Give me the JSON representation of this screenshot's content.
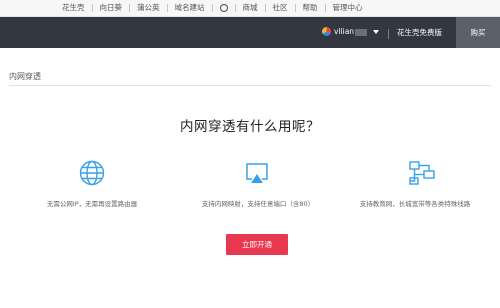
{
  "topnav": {
    "items": [
      "花生壳",
      "向日葵",
      "蒲公英",
      "域名建站",
      "商城",
      "社区",
      "帮助",
      "管理中心"
    ]
  },
  "header": {
    "user_name": "vllian",
    "product_name": "花生壳免费版",
    "buy_label": "购买",
    "brand_color": "#333742"
  },
  "breadcrumb": "内网穿透",
  "main": {
    "title": "内网穿透有什么用呢？",
    "features": [
      {
        "icon": "globe-icon",
        "text": "无需公网IP，无需再设置路由器"
      },
      {
        "icon": "screen-mapping-icon",
        "text": "支持内网映射，支持任意端口（含80）"
      },
      {
        "icon": "network-topology-icon",
        "text": "支持教育网，长城宽带等各类特殊线路"
      }
    ],
    "cta_label": "立即开通",
    "accent_color": "#e8384f",
    "icon_color": "#3aa0e8"
  }
}
